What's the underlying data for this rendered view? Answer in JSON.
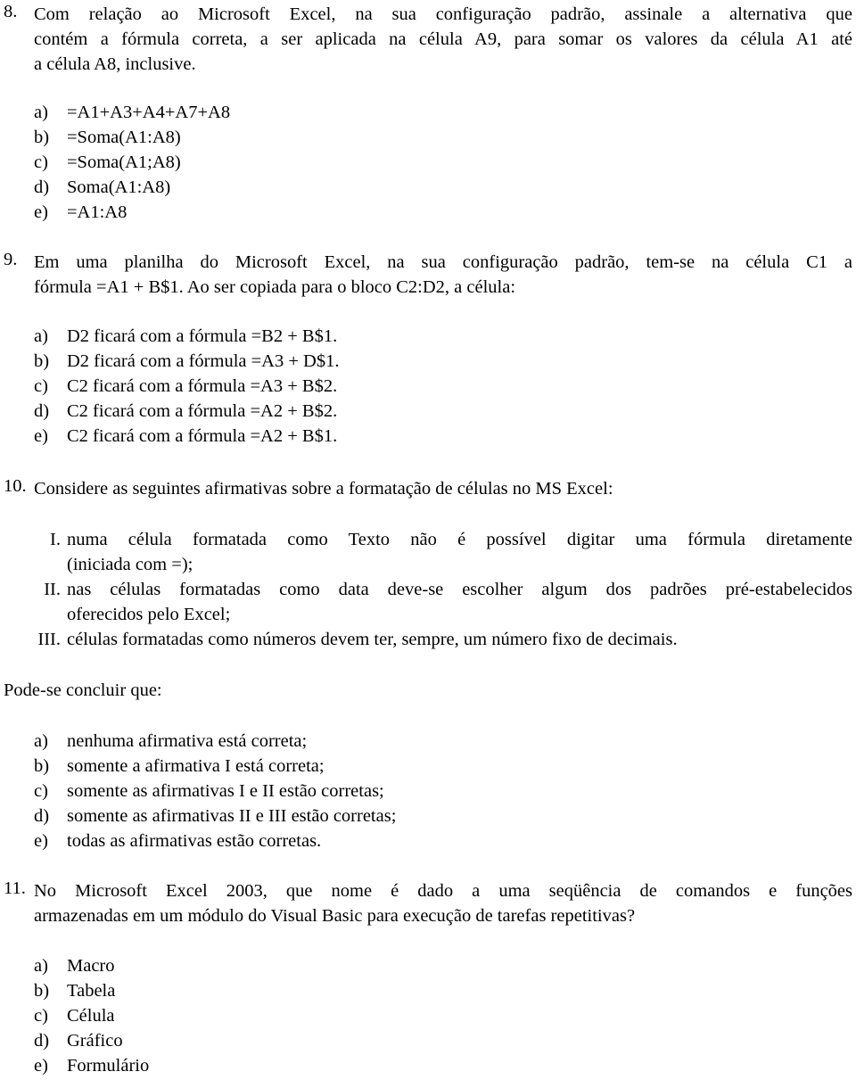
{
  "questions": [
    {
      "number": "8.",
      "lines": [
        "Com relação ao Microsoft Excel, na sua configuração padrão, assinale a alternativa que",
        "contém a fórmula correta, a ser aplicada na célula A9, para somar os valores da célula A1 até",
        "a célula A8, inclusive."
      ],
      "options": [
        {
          "letter": "a)",
          "text": "=A1+A3+A4+A7+A8"
        },
        {
          "letter": "b)",
          "text": "=Soma(A1:A8)"
        },
        {
          "letter": "c)",
          "text": "=Soma(A1;A8)"
        },
        {
          "letter": "d)",
          "text": "Soma(A1:A8)"
        },
        {
          "letter": "e)",
          "text": "=A1:A8"
        }
      ]
    },
    {
      "number": "9.",
      "lines": [
        "Em uma planilha do Microsoft Excel, na sua configuração padrão, tem-se na célula C1 a",
        "fórmula =A1 + B$1. Ao ser copiada para o bloco C2:D2, a célula:"
      ],
      "options": [
        {
          "letter": "a)",
          "text": "D2 ficará com a fórmula =B2 + B$1."
        },
        {
          "letter": "b)",
          "text": "D2 ficará com a fórmula =A3 + D$1."
        },
        {
          "letter": "c)",
          "text": "C2 ficará com a fórmula =A3 + B$2."
        },
        {
          "letter": "d)",
          "text": "C2 ficará com a fórmula =A2 + B$2."
        },
        {
          "letter": "e)",
          "text": "C2 ficará com a fórmula =A2 + B$1."
        }
      ]
    },
    {
      "number": "10.",
      "lines": [
        "Considere as seguintes afirmativas sobre a formatação de células no MS Excel:"
      ],
      "statements": [
        {
          "roman": "I.",
          "lines": [
            "numa célula formatada como Texto não é possível digitar uma fórmula diretamente",
            "(iniciada com =);"
          ]
        },
        {
          "roman": "II.",
          "lines": [
            "nas células formatadas como data deve-se escolher algum dos padrões pré-estabelecidos",
            "oferecidos pelo Excel;"
          ]
        },
        {
          "roman": "III.",
          "lines": [
            "células formatadas como números devem ter, sempre, um número fixo de decimais."
          ]
        }
      ],
      "conclusion": "Pode-se concluir que:",
      "options": [
        {
          "letter": "a)",
          "text": "nenhuma afirmativa está correta;"
        },
        {
          "letter": "b)",
          "text": "somente a afirmativa I está correta;"
        },
        {
          "letter": "c)",
          "text": "somente as afirmativas I e II estão corretas;"
        },
        {
          "letter": "d)",
          "text": "somente as afirmativas II e III estão corretas;"
        },
        {
          "letter": "e)",
          "text": "todas as afirmativas estão corretas."
        }
      ]
    },
    {
      "number": "11.",
      "lines": [
        "No Microsoft Excel 2003, que nome é dado a uma seqüência de comandos e funções",
        "armazenadas em um módulo do Visual Basic para execução de tarefas repetitivas?"
      ],
      "options": [
        {
          "letter": "a)",
          "text": "Macro"
        },
        {
          "letter": "b)",
          "text": "Tabela"
        },
        {
          "letter": "c)",
          "text": "Célula"
        },
        {
          "letter": "d)",
          "text": "Gráfico"
        },
        {
          "letter": "e)",
          "text": "Formulário"
        }
      ]
    }
  ]
}
